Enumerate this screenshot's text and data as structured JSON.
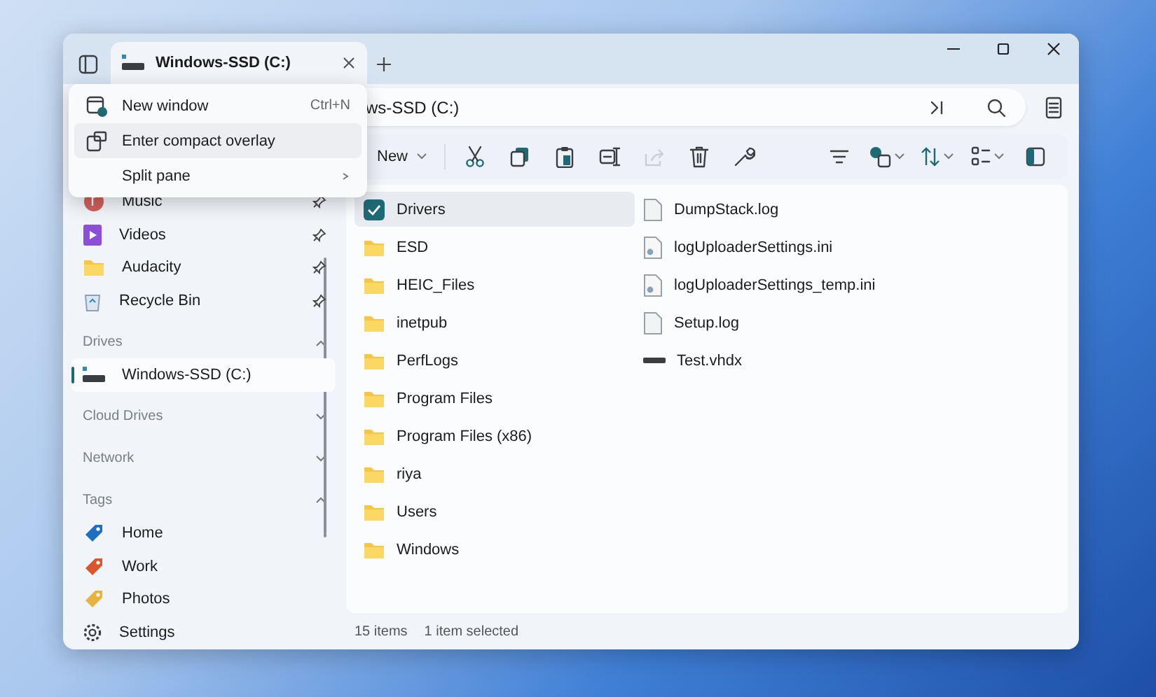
{
  "window": {
    "tabs": [
      {
        "title": "Windows-SSD (C:)",
        "selected": true
      }
    ]
  },
  "menu": {
    "items": [
      {
        "label": "New window",
        "shortcut": "Ctrl+N",
        "kind": "newwin",
        "highlighted": false,
        "submenu": false
      },
      {
        "label": "Enter compact overlay",
        "kind": "overlay",
        "highlighted": true,
        "submenu": false
      },
      {
        "label": "Split pane",
        "kind": "none",
        "highlighted": false,
        "submenu": true
      }
    ]
  },
  "address": {
    "path": "ws-SSD (C:)"
  },
  "toolbar": {
    "new_label": "New",
    "actions": [
      {
        "kind": "cut",
        "disabled": false
      },
      {
        "kind": "copy",
        "disabled": false
      },
      {
        "kind": "paste",
        "disabled": false
      },
      {
        "kind": "rename",
        "disabled": false
      },
      {
        "kind": "share",
        "disabled": true
      },
      {
        "kind": "delete",
        "disabled": false
      },
      {
        "kind": "properties",
        "disabled": false
      }
    ]
  },
  "sidebar": {
    "pinned": [
      {
        "label": "Music",
        "kind": "music"
      },
      {
        "label": "Videos",
        "kind": "videos"
      },
      {
        "label": "Audacity",
        "kind": "folder"
      },
      {
        "label": "Recycle Bin",
        "kind": "recycle"
      }
    ],
    "sections": [
      {
        "title": "Drives",
        "expanded": true,
        "items": [
          {
            "label": "Windows-SSD (C:)",
            "kind": "drive",
            "selected": true
          }
        ]
      },
      {
        "title": "Cloud Drives",
        "expanded": false
      },
      {
        "title": "Network",
        "expanded": false
      },
      {
        "title": "Tags",
        "expanded": true,
        "items": [
          {
            "label": "Home",
            "kind": "tag",
            "color": "#1f6fc0",
            "selected": false
          },
          {
            "label": "Work",
            "kind": "tag",
            "color": "#d9572b",
            "selected": false
          },
          {
            "label": "Photos",
            "kind": "tag",
            "color": "#e6b43c",
            "selected": false
          }
        ]
      }
    ],
    "settings": "Settings"
  },
  "files": [
    {
      "name": "Drivers",
      "kind": "folder",
      "selected": true
    },
    {
      "name": "ESD",
      "kind": "folder",
      "selected": false
    },
    {
      "name": "HEIC_Files",
      "kind": "folder",
      "selected": false
    },
    {
      "name": "inetpub",
      "kind": "folder",
      "selected": false
    },
    {
      "name": "PerfLogs",
      "kind": "folder",
      "selected": false
    },
    {
      "name": "Program Files",
      "kind": "folder",
      "selected": false
    },
    {
      "name": "Program Files (x86)",
      "kind": "folder",
      "selected": false
    },
    {
      "name": "riya",
      "kind": "folder",
      "selected": false
    },
    {
      "name": "Users",
      "kind": "folder",
      "selected": false
    },
    {
      "name": "Windows",
      "kind": "folder",
      "selected": false
    },
    {
      "name": "DumpStack.log",
      "kind": "text",
      "selected": false
    },
    {
      "name": "logUploaderSettings.ini",
      "kind": "settings",
      "selected": false
    },
    {
      "name": "logUploaderSettings_temp.ini",
      "kind": "settings",
      "selected": false
    },
    {
      "name": "Setup.log",
      "kind": "text",
      "selected": false
    },
    {
      "name": "Test.vhdx",
      "kind": "disk",
      "selected": false
    }
  ],
  "status_bar": {
    "count": "15 items",
    "selection": "1 item selected"
  }
}
